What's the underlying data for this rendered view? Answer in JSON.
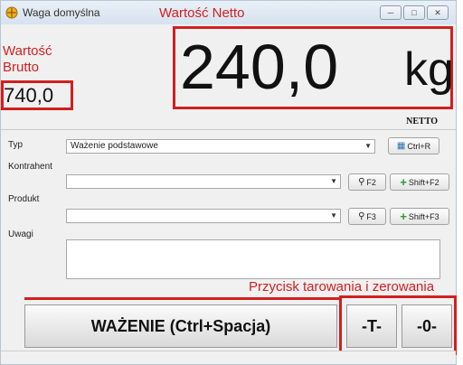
{
  "window": {
    "title": "Waga domyślna"
  },
  "annotations": {
    "netto": "Wartość Netto",
    "brutto_line1": "Wartość",
    "brutto_line2": "Brutto",
    "buttons": "Przycisk tarowania i zerowania"
  },
  "display": {
    "netto_value": "240,0",
    "unit": "kg",
    "brutto_value": "740,0",
    "mode": "NETTO"
  },
  "form": {
    "typ_label": "Typ",
    "typ_value": "Ważenie podstawowe",
    "typ_shortcut": "Ctrl+R",
    "kontrahent_label": "Kontrahent",
    "kontrahent_search": "F2",
    "kontrahent_add": "Shift+F2",
    "produkt_label": "Produkt",
    "produkt_search": "F3",
    "produkt_add": "Shift+F3",
    "uwagi_label": "Uwagi"
  },
  "actions": {
    "weigh": "WAŻENIE (Ctrl+Spacja)",
    "tare": "-T-",
    "zero": "-0-"
  }
}
